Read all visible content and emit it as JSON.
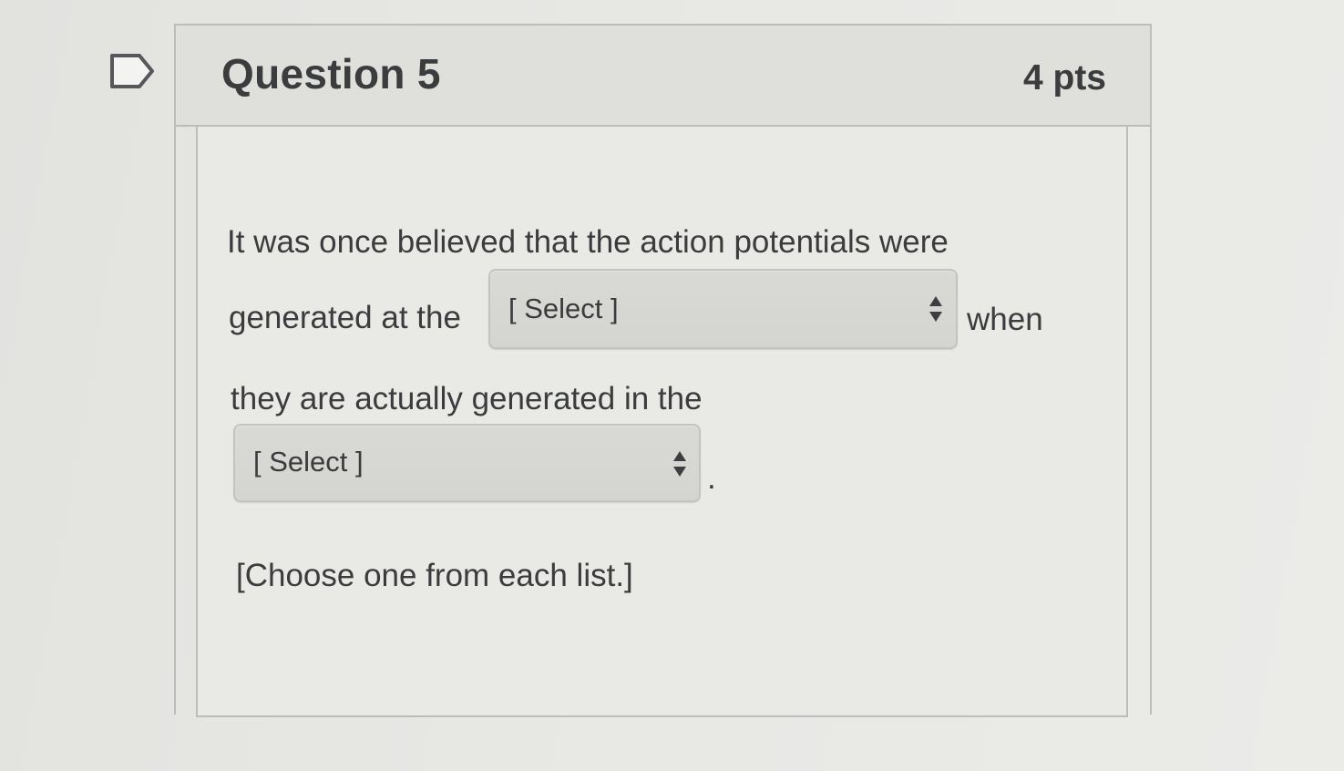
{
  "question": {
    "title": "Question 5",
    "points": "4 pts",
    "flag_icon": "bookmark-flag-icon"
  },
  "body": {
    "line1": "It was once believed that the action potentials were",
    "line2_before": "generated at the",
    "line2_after": "when",
    "line3": "they are actually generated in the",
    "period": ".",
    "instruction": "[Choose one from each list.]"
  },
  "dropdowns": [
    {
      "selected": "[ Select ]",
      "icon": "up-down-arrows-icon"
    },
    {
      "selected": "[ Select ]",
      "icon": "up-down-arrows-icon"
    }
  ],
  "colors": {
    "header_bg": "#dfdfdc",
    "border": "#bdbdba",
    "text": "#3b3c3e"
  }
}
